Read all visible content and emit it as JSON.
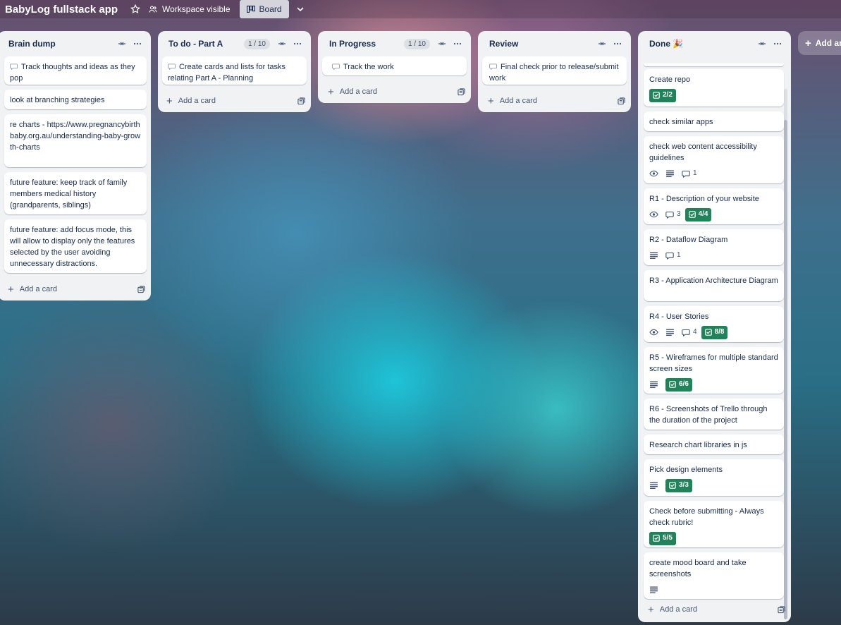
{
  "header": {
    "board_title": "BabyLog fullstack app",
    "visibility_label": "Workspace visible",
    "board_view_label": "Board"
  },
  "lists": {
    "brain": {
      "title": "Brain dump",
      "cards": [
        "Track thoughts and ideas as they pop",
        "look at branching strategies",
        "re charts - https://www.pregnancybirthbaby.org.au/understanding-baby-growth-charts",
        "future feature: keep track of family members medical history (grandparents, siblings)",
        "future feature: add focus mode, this will allow to display only the features selected by the user avoiding unnecessary distractions."
      ],
      "add_card": "Add a card"
    },
    "todo": {
      "title": "To do - Part A",
      "count": "1 / 10",
      "cards": [
        "Create cards and lists for tasks relating Part A - Planning"
      ],
      "add_card": "Add a card"
    },
    "progress": {
      "title": "In Progress",
      "count": "1 / 10",
      "cards": [
        "Track the work"
      ],
      "add_card": "Add a card"
    },
    "review": {
      "title": "Review",
      "cards": [
        "Final check prior to release/submit work"
      ],
      "add_card": "Add a card"
    },
    "done": {
      "title": "Done 🎉",
      "cards": [
        {
          "title": "Create repo",
          "checklist": "2/2"
        },
        {
          "title": "check similar apps"
        },
        {
          "title": "check web content accessibility guidelines",
          "comments": "1"
        },
        {
          "title": "R1 - Description of your website",
          "comments": "3",
          "checklist": "4/4"
        },
        {
          "title": "R2 - Dataflow Diagram",
          "comments": "1"
        },
        {
          "title": "R3 - Application Architecture Diagram"
        },
        {
          "title": "R4 - User Stories",
          "comments": "4",
          "checklist": "8/8"
        },
        {
          "title": "R5 - Wireframes for multiple standard screen sizes",
          "checklist": "6/6"
        },
        {
          "title": "R6 - Screenshots of Trello through the duration of the project"
        },
        {
          "title": "Research chart libraries in js"
        },
        {
          "title": "Pick design elements",
          "checklist": "3/3"
        },
        {
          "title": "Check before submitting - Always check rubric!",
          "checklist": "5/5"
        },
        {
          "title": "create mood board and take screenshots"
        }
      ],
      "add_card": "Add a card"
    }
  },
  "add_list_label": "Add another list",
  "icons": {
    "star": "star-icon",
    "visibility": "people-icon",
    "board": "board-icon",
    "collapse": "collapse-icon",
    "more": "more-icon",
    "watch": "watch-icon",
    "description": "description-icon",
    "comment": "comment-icon",
    "checklist": "checklist-icon",
    "template": "template-icon"
  }
}
